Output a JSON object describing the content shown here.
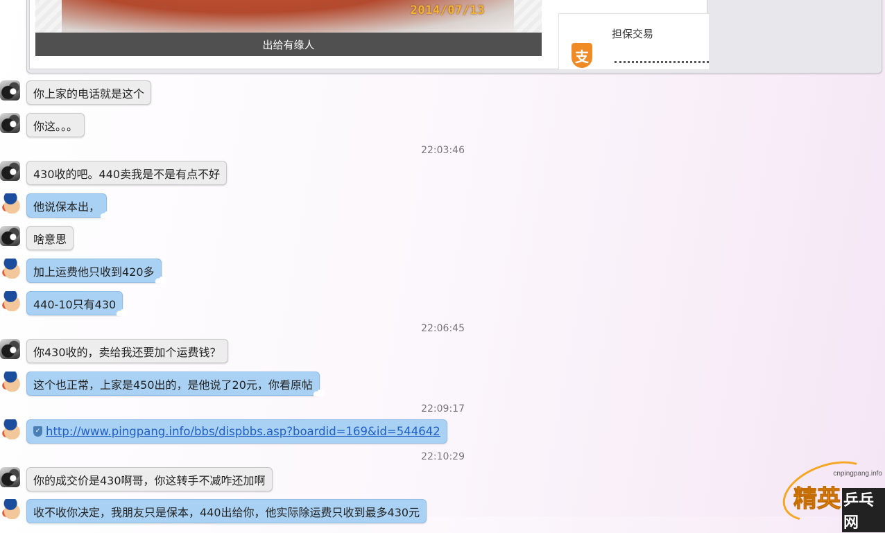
{
  "share_card": {
    "photo_date": "2014/07/13",
    "caption": "出给有缘人",
    "guarantee_icon": "支",
    "guarantee_title": "担保交易"
  },
  "timestamps": [
    "22:03:46",
    "22:06:45",
    "22:09:17",
    "22:10:29"
  ],
  "messages": [
    {
      "sender": "dog",
      "text": "你上家的电话就是这个"
    },
    {
      "sender": "dog",
      "text": "你这。。。"
    },
    {
      "sender": "dog",
      "text": "430收的吧。440卖我是不是有点不好"
    },
    {
      "sender": "cop",
      "text": "他说保本出，"
    },
    {
      "sender": "dog",
      "text": "啥意思"
    },
    {
      "sender": "cop",
      "text": "加上运费他只收到420多"
    },
    {
      "sender": "cop",
      "text": "440-10只有430"
    },
    {
      "sender": "dog",
      "text": "你430收的，卖给我还要加个运费钱？"
    },
    {
      "sender": "cop",
      "text": "这个也正常，上家是450出的，是他说了20元，你看原帖"
    },
    {
      "sender": "cop",
      "text": "http://www.pingpang.info/bbs/dispbbs.asp?boardid=169&id=544642"
    },
    {
      "sender": "dog",
      "text": "你的成交价是430啊哥，你这转手不减咋还加啊"
    },
    {
      "sender": "cop",
      "text": "收不收你决定，我朋友只是保本，440出给你，他实际除运费只收到最多430元"
    }
  ],
  "watermark": {
    "site": "cnpingpang.info",
    "brand_a": "精英",
    "brand_b": "乒乓网"
  }
}
